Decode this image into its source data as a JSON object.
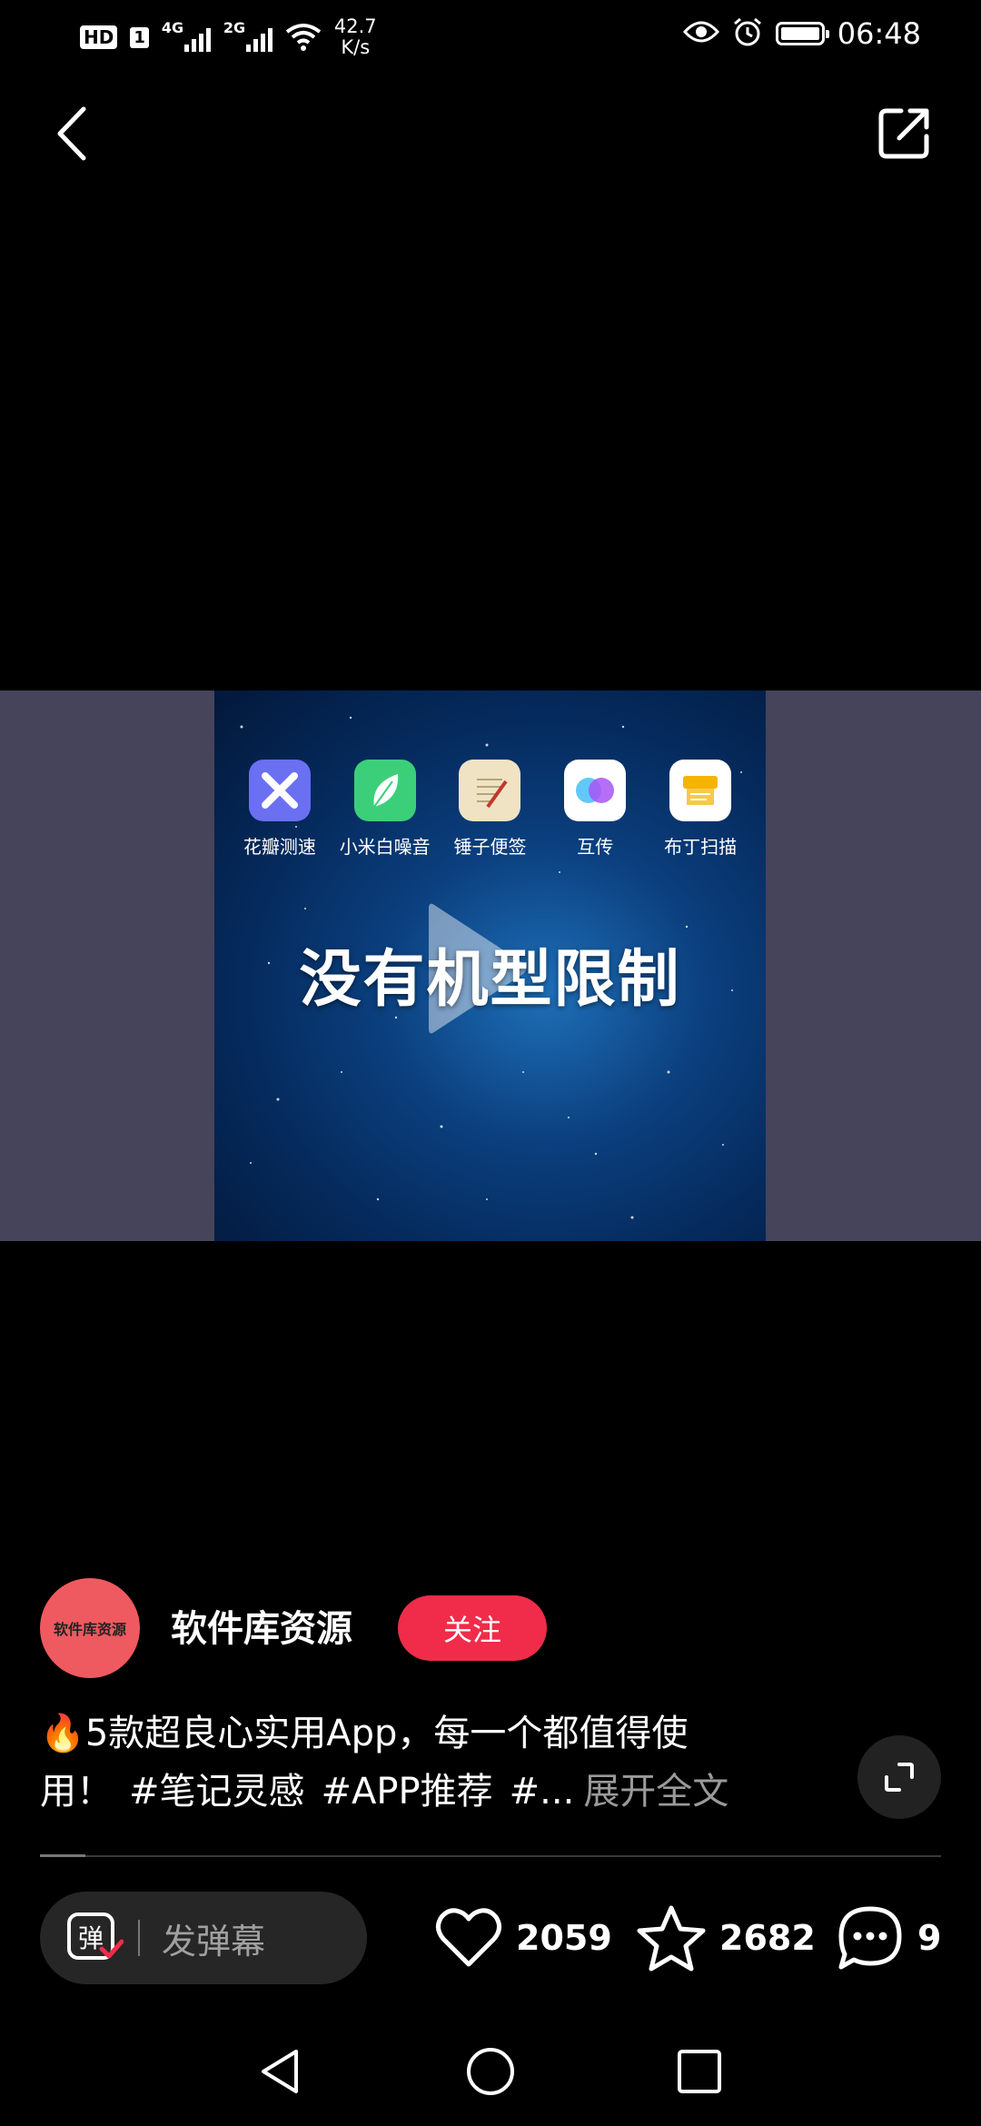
{
  "status_bar": {
    "hd": "HD",
    "sim": "1",
    "net1": "4G",
    "net2": "2G",
    "speed_value": "42.7",
    "speed_unit": "K/s",
    "time": "06:48",
    "battery_level": 1.0,
    "icons": [
      "hd-icon",
      "signal-icon",
      "wifi-icon",
      "eye-icon",
      "alarm-icon",
      "battery-icon"
    ]
  },
  "top_bar": {
    "icons": [
      "back-icon",
      "share-icon"
    ]
  },
  "video": {
    "headline": "没有机型限制",
    "apps": [
      {
        "label": "花瓣测速",
        "icon": "petal-speedtest-icon",
        "color": "#6b6ff2"
      },
      {
        "label": "小米白噪音",
        "icon": "xiaomi-whitenoise-icon",
        "color": "#3ccf7a"
      },
      {
        "label": "锤子便签",
        "icon": "smartisan-notes-icon",
        "color": "#efe3c4"
      },
      {
        "label": "互传",
        "icon": "share-transfer-icon",
        "color": "#ffffff"
      },
      {
        "label": "布丁扫描",
        "icon": "pudding-scan-icon",
        "color": "#ffffff"
      }
    ],
    "band_color": "#45445a"
  },
  "author": {
    "avatar_text": "软件库资源",
    "avatar_color": "#ee5a60",
    "name": "软件库资源",
    "follow_label": "关注",
    "follow_color": "#f02c4a"
  },
  "caption": {
    "emoji": "🔥",
    "line1": "5款超良心实用App，每一个都值得使",
    "line2_start": "用！",
    "tag1": "#笔记灵感",
    "tag2": "#APP推荐",
    "tag3": "#...",
    "expand": "展开全文"
  },
  "progress": {
    "fraction": 0.05
  },
  "actions": {
    "danmu_placeholder": "发弹幕",
    "danmu_glyph": "弹",
    "likes": "2059",
    "favorites": "2682",
    "comments": "9"
  },
  "nav_bar": {
    "icons": [
      "nav-back-icon",
      "nav-home-icon",
      "nav-recents-icon"
    ]
  }
}
